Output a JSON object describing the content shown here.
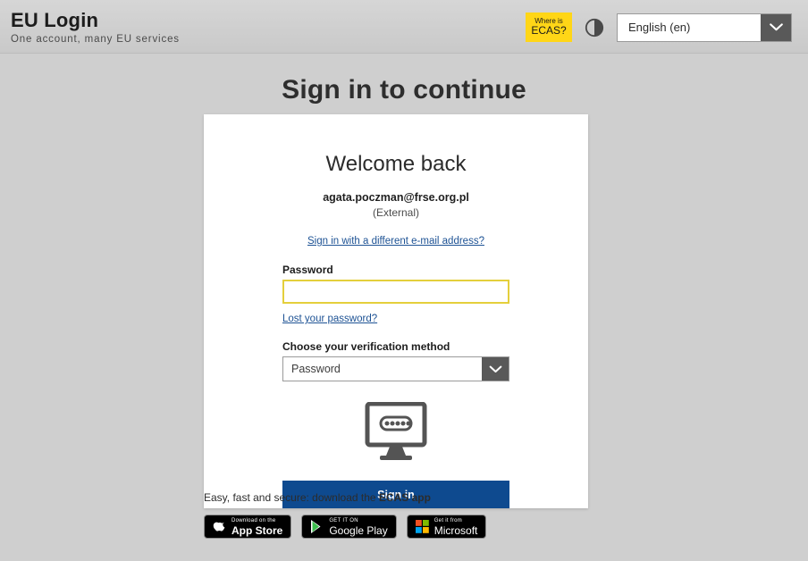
{
  "header": {
    "brand_title": "EU Login",
    "brand_subtitle": "One account, many EU services",
    "ecas_badge_line1": "Where is",
    "ecas_badge_line2": "ECAS?",
    "contrast_icon": "contrast-toggle-icon",
    "language": {
      "selected": "English (en)",
      "arrow_icon": "chevron-down-icon"
    },
    "colors": {
      "badge_yellow": "#ffd617",
      "header_bg": "#d0d0d0"
    }
  },
  "page": {
    "title": "Sign in to continue"
  },
  "card": {
    "welcome": "Welcome back",
    "email": "agata.poczman@frse.org.pl",
    "account_type": "(External)",
    "different_email_link": "Sign in with a different e-mail address?",
    "password": {
      "label": "Password",
      "value": "",
      "placeholder": "",
      "border_color": "#e4cf3c"
    },
    "lost_password_link": "Lost your password?",
    "verification": {
      "label": "Choose your verification method",
      "selected": "Password",
      "arrow_icon": "chevron-down-icon"
    },
    "illustration_icon": "monitor-password-icon",
    "signin_button": "Sign in",
    "signin_color": "#0e4a8f"
  },
  "footer": {
    "text_prefix": "Easy, fast and secure: download the ",
    "text_strong": "ECAS app",
    "badges": [
      {
        "name": "app-store-badge",
        "icon": "apple-icon",
        "small": "Download on the",
        "big": "App Store"
      },
      {
        "name": "google-play-badge",
        "icon": "google-play-icon",
        "small": "GET IT ON",
        "big": "Google Play"
      },
      {
        "name": "microsoft-store-badge",
        "icon": "microsoft-icon",
        "small": "Get it from",
        "big": "Microsoft"
      }
    ]
  }
}
